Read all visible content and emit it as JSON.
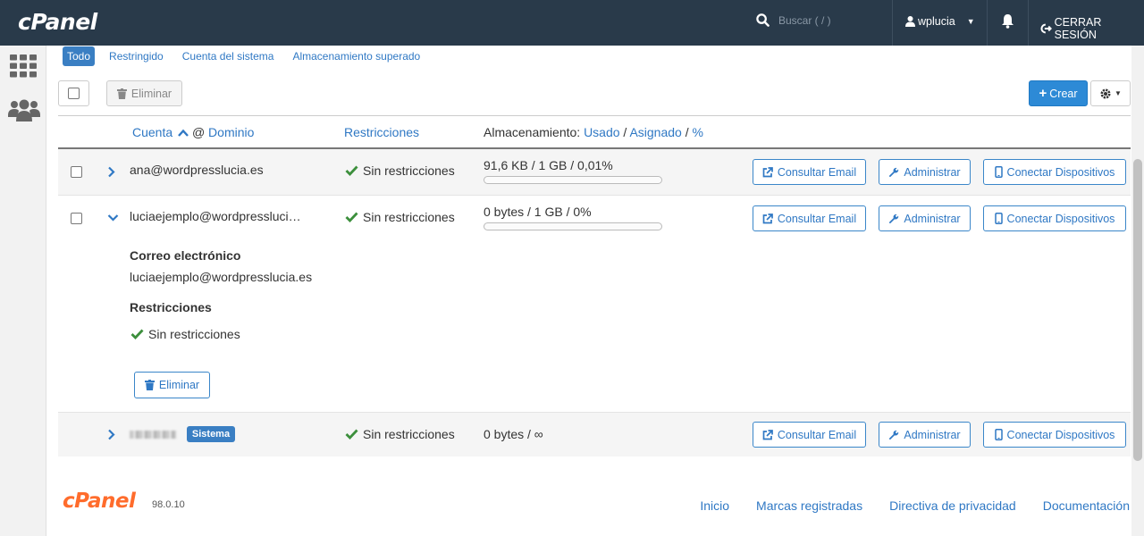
{
  "header": {
    "logo": "cPanel",
    "search_placeholder": "Buscar ( / )",
    "user": "wplucia",
    "logout": "CERRAR SESIÓN"
  },
  "filters": [
    "Todo",
    "Restringido",
    "Cuenta del sistema",
    "Almacenamiento superado"
  ],
  "toolbar": {
    "delete": "Eliminar",
    "create": "Crear"
  },
  "table": {
    "headers": {
      "account": "Cuenta",
      "at": "@",
      "domain": "Dominio",
      "restrictions": "Restricciones",
      "storage": "Almacenamiento:",
      "used": "Usado",
      "slash1": "/",
      "assigned": "Asignado",
      "slash2": "/",
      "percent": "%"
    },
    "rows": [
      {
        "account": "ana@wordpresslucia.es",
        "restriction": "Sin restricciones",
        "storage": "91,6 KB / 1 GB / 0,01%",
        "usage_fraction": 0.0001,
        "btn_email": "Consultar Email",
        "btn_manage": "Administrar",
        "btn_connect": "Conectar Dispositivos"
      },
      {
        "account": "luciaejemplo@wordpressluci…",
        "restriction": "Sin restricciones",
        "storage": "0 bytes / 1 GB / 0%",
        "usage_fraction": 0,
        "btn_email": "Consultar Email",
        "btn_manage": "Administrar",
        "btn_connect": "Conectar Dispositivos",
        "detail": {
          "email_label": "Correo electrónico",
          "email_value": "luciaejemplo@wordpresslucia.es",
          "restr_label": "Restricciones",
          "restr_value": "Sin restricciones",
          "delete": "Eliminar"
        }
      },
      {
        "account_badge": "Sistema",
        "restriction": "Sin restricciones",
        "storage": "0 bytes / ∞",
        "btn_email": "Consultar Email",
        "btn_manage": "Administrar",
        "btn_connect": "Conectar Dispositivos"
      }
    ]
  },
  "footer": {
    "logo": "cPanel",
    "version": "98.0.10",
    "links": [
      "Inicio",
      "Marcas registradas",
      "Directiva de privacidad",
      "Documentación"
    ]
  },
  "colors": {
    "topbar": "#293a4a",
    "link": "#2f78c4",
    "primary": "#2d8ad6",
    "check": "#3c8f3c",
    "footer_logo": "#ff6c2c"
  }
}
